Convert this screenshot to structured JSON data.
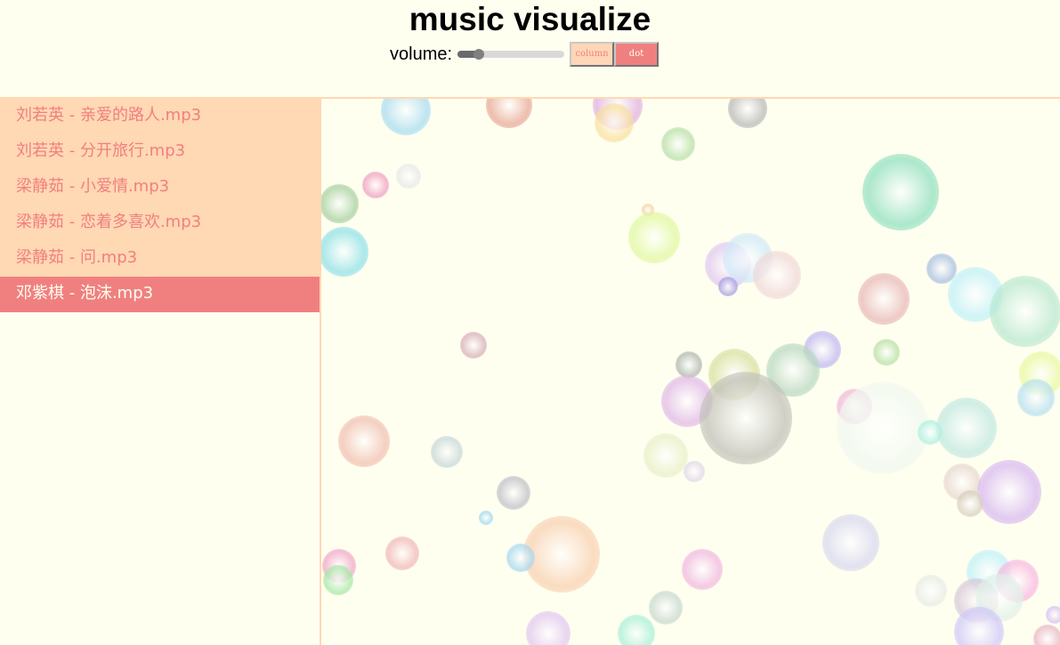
{
  "header": {
    "title": "music visualize",
    "volume_label": "volume:",
    "volume_value": 0.2,
    "buttons": {
      "column": "column",
      "dot": "dot"
    },
    "active_mode": "dot"
  },
  "colors": {
    "background": "#fffff0",
    "sidebar_bg": "#ffd8b4",
    "accent": "#f08080",
    "active_text": "#fffff0"
  },
  "playlist": {
    "items": [
      {
        "label": "刘若英 - 亲爱的路人.mp3",
        "active": false
      },
      {
        "label": "刘若英 - 分开旅行.mp3",
        "active": false
      },
      {
        "label": "梁静茹 - 小爱情.mp3",
        "active": false
      },
      {
        "label": "梁静茹 - 恋着多喜欢.mp3",
        "active": false
      },
      {
        "label": "梁静茹 - 问.mp3",
        "active": false
      },
      {
        "label": "邓紫棋 - 泡沫.mp3",
        "active": true
      }
    ]
  }
}
